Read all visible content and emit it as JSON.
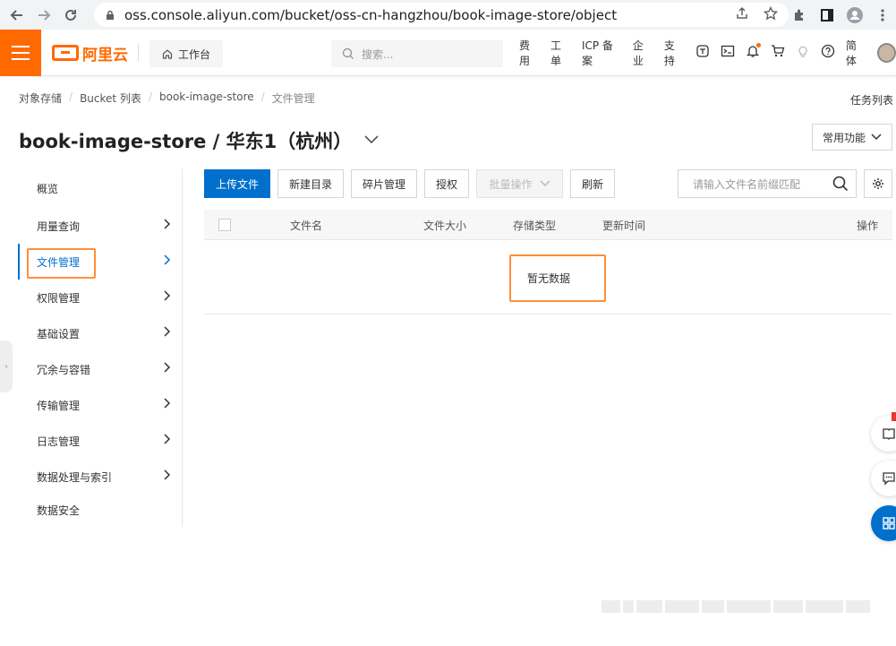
{
  "browser": {
    "url": "oss.console.aliyun.com/bucket/oss-cn-hangzhou/book-image-store/object"
  },
  "topbar": {
    "logo_text": "阿里云",
    "workbench_label": "工作台",
    "search_placeholder": "搜索...",
    "nav": {
      "billing": "费用",
      "ticket": "工单",
      "icp": "ICP 备案",
      "enterprise": "企业",
      "support": "支持",
      "language": "简体"
    }
  },
  "breadcrumb": {
    "items": [
      "对象存储",
      "Bucket 列表",
      "book-image-store"
    ],
    "current": "文件管理"
  },
  "task_list_label": "任务列表",
  "page": {
    "title": "book-image-store / 华东1（杭州）",
    "common_functions_label": "常用功能"
  },
  "sidebar": {
    "items": [
      {
        "label": "概览"
      },
      {
        "label": "用量查询"
      },
      {
        "label": "文件管理"
      },
      {
        "label": "权限管理"
      },
      {
        "label": "基础设置"
      },
      {
        "label": "冗余与容错"
      },
      {
        "label": "传输管理"
      },
      {
        "label": "日志管理"
      },
      {
        "label": "数据处理与索引"
      },
      {
        "label": "数据安全"
      }
    ]
  },
  "toolbar": {
    "upload": "上传文件",
    "new_dir": "新建目录",
    "fragments": "碎片管理",
    "authorize": "授权",
    "batch": "批量操作",
    "refresh": "刷新",
    "search_placeholder": "请输入文件名前缀匹配"
  },
  "table": {
    "columns": {
      "name": "文件名",
      "size": "文件大小",
      "storage": "存储类型",
      "updated": "更新时间",
      "actions": "操作"
    },
    "empty_text": "暂无数据"
  },
  "colors": {
    "brand": "#ff6a00",
    "primary": "#0070cc",
    "highlight": "#ff8f3a"
  }
}
